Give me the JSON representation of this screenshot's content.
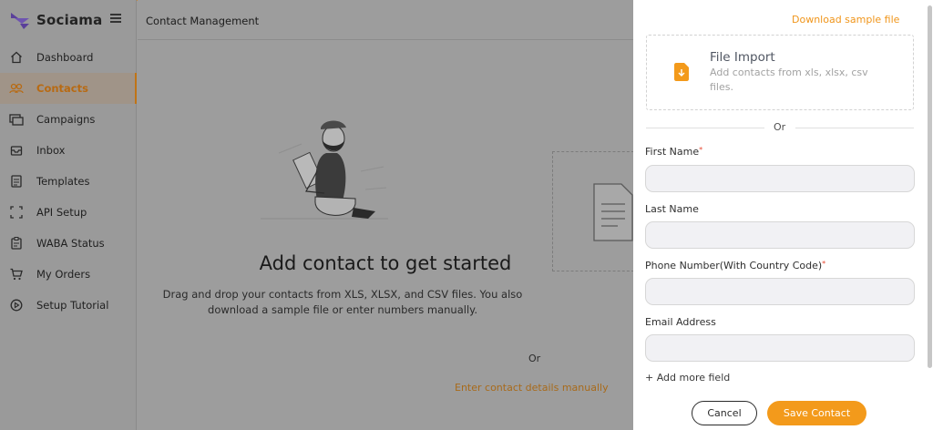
{
  "brand": {
    "name": "Sociama"
  },
  "sidebar": {
    "items": [
      {
        "label": "Dashboard",
        "icon": "home-icon"
      },
      {
        "label": "Contacts",
        "icon": "contacts-icon",
        "active": true
      },
      {
        "label": "Campaigns",
        "icon": "campaigns-icon"
      },
      {
        "label": "Inbox",
        "icon": "inbox-icon"
      },
      {
        "label": "Templates",
        "icon": "templates-icon"
      },
      {
        "label": "API Setup",
        "icon": "api-setup-icon"
      },
      {
        "label": "WABA Status",
        "icon": "waba-status-icon"
      },
      {
        "label": "My Orders",
        "icon": "cart-icon"
      },
      {
        "label": "Setup Tutorial",
        "icon": "play-circle-icon"
      }
    ]
  },
  "header": {
    "title": "Contact Management"
  },
  "main": {
    "empty_title": "Add contact to get started",
    "empty_description": "Drag and drop your contacts from XLS, XLSX, and CSV files. You also download a sample file or enter numbers manually.",
    "or_text": "Or",
    "manual_link": "Enter contact details manually"
  },
  "panel": {
    "download_link": "Download sample file",
    "import": {
      "title": "File Import",
      "subtitle": "Add contacts from xls, xlsx, csv files."
    },
    "or_text": "Or",
    "fields": {
      "first_name": {
        "label": "First Name",
        "required_mark": "*",
        "value": "",
        "placeholder": ""
      },
      "last_name": {
        "label": "Last Name",
        "value": "",
        "placeholder": ""
      },
      "phone": {
        "label": "Phone Number(With Country Code)",
        "required_mark": "*",
        "value": "",
        "placeholder": ""
      },
      "email": {
        "label": "Email Address",
        "value": "",
        "placeholder": ""
      }
    },
    "add_more_field": "+ Add more field",
    "cancel_label": "Cancel",
    "save_label": "Save Contact"
  },
  "colors": {
    "accent": "#f39a1b",
    "link_orange": "#f0951a",
    "overlay_gray": "#9d9d9d",
    "active_text": "#b86a12"
  }
}
